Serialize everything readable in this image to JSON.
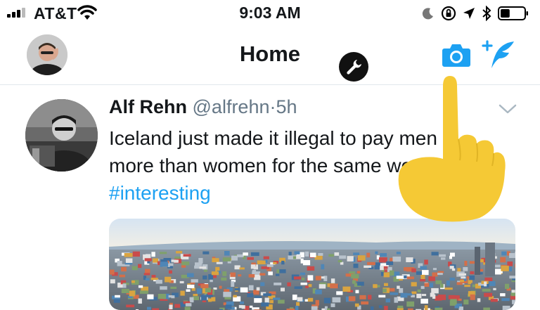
{
  "status_bar": {
    "carrier": "AT&T",
    "time": "9:03 AM",
    "icons": [
      "signal-bars-icon",
      "wifi-icon",
      "moon-icon",
      "orientation-lock-icon",
      "location-icon",
      "bluetooth-icon",
      "battery-icon"
    ],
    "battery_level": 0.4
  },
  "nav": {
    "title": "Home",
    "icons": [
      "profile-avatar",
      "wrench-icon",
      "camera-icon",
      "compose-tweet-icon"
    ]
  },
  "tweet": {
    "author_name": "Alf Rehn",
    "author_handle": "@alfrehn",
    "separator": "·",
    "time": "5h",
    "text_line1": "Iceland just made it illegal to pay men",
    "text_line2": "more than women for the same work.",
    "hashtag": "#interesting",
    "more_icon": "chevron-down-icon"
  },
  "colors": {
    "accent": "#1da1f2",
    "text": "#14171a",
    "secondary_text": "#657786",
    "hand": "#f5c935"
  }
}
